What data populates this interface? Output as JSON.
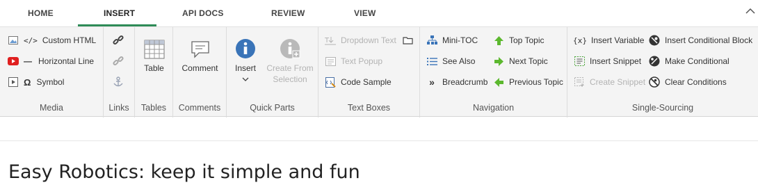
{
  "tabs": [
    "HOME",
    "INSERT",
    "API DOCS",
    "REVIEW",
    "VIEW"
  ],
  "groups": {
    "media": {
      "label": "Media",
      "items": [
        "Custom HTML",
        "Horizontal Line",
        "Symbol"
      ]
    },
    "links": {
      "label": "Links"
    },
    "tables": {
      "label": "Tables",
      "table": "Table"
    },
    "comments": {
      "label": "Comments",
      "comment": "Comment"
    },
    "quick_parts": {
      "label": "Quick Parts",
      "insert": "Insert",
      "create_from_1": "Create From",
      "create_from_2": "Selection"
    },
    "text_boxes": {
      "label": "Text Boxes",
      "items": [
        "Dropdown Text",
        "Text Popup",
        "Code Sample"
      ]
    },
    "navigation": {
      "label": "Navigation",
      "left": [
        "Mini-TOC",
        "See Also",
        "Breadcrumb"
      ],
      "right": [
        "Top Topic",
        "Next Topic",
        "Previous Topic"
      ]
    },
    "single_sourcing": {
      "label": "Single-Sourcing",
      "left": [
        "Insert Variable",
        "Insert Snippet",
        "Create Snippet"
      ],
      "right": [
        "Insert Conditional Block",
        "Make Conditional",
        "Clear Conditions"
      ]
    }
  },
  "document": {
    "title": "Easy Robotics: keep it simple and fun"
  },
  "colors": {
    "accent": "#2e8b57",
    "info_blue": "#3a74b8",
    "arrow_green": "#5cb82e"
  }
}
